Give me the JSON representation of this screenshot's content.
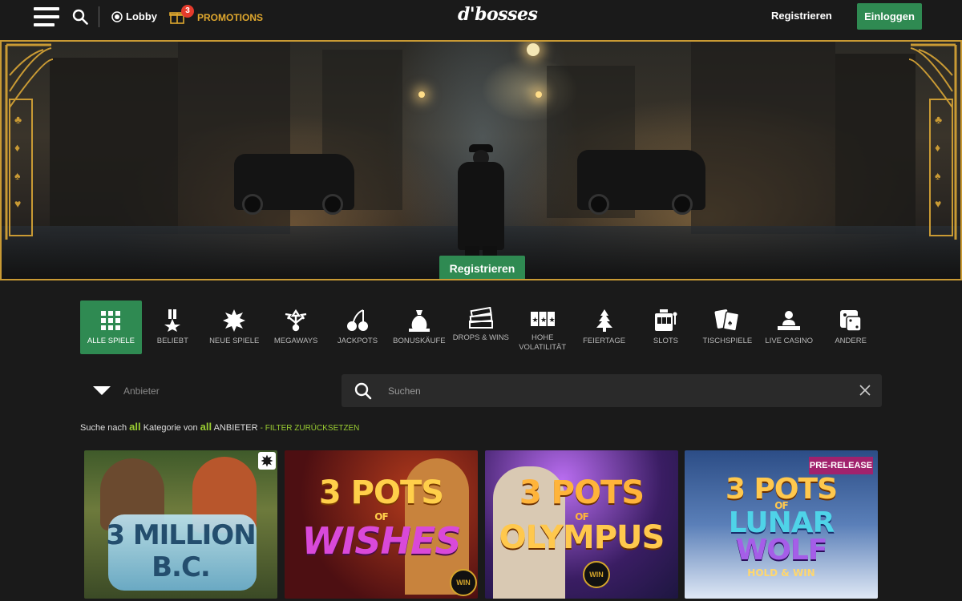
{
  "header": {
    "lobby_label": "Lobby",
    "promo_count": "3",
    "promo_label": "PROMOTIONS",
    "logo_text": "d'bosses",
    "register_label": "Registrieren",
    "login_label": "Einloggen"
  },
  "banner": {
    "cta_label": "Registrieren"
  },
  "categories": [
    {
      "label": "ALLE SPIELE",
      "icon": "grid-icon",
      "active": true
    },
    {
      "label": "BELIEBT",
      "icon": "medal-icon"
    },
    {
      "label": "NEUE SPIELE",
      "icon": "burst-icon"
    },
    {
      "label": "MEGAWAYS",
      "icon": "arrows-icon"
    },
    {
      "label": "JACKPOTS",
      "icon": "cherries-icon"
    },
    {
      "label": "BONUSKÄUFE",
      "icon": "money-bag-icon"
    },
    {
      "label": "DROPS & WINS",
      "icon": "stack-icon"
    },
    {
      "label": "HOHE VOLATILITÄT",
      "icon": "stars-icon"
    },
    {
      "label": "FEIERTAGE",
      "icon": "tree-icon"
    },
    {
      "label": "SLOTS",
      "icon": "slot-machine-icon"
    },
    {
      "label": "TISCHSPIELE",
      "icon": "cards-icon"
    },
    {
      "label": "LIVE CASINO",
      "icon": "dealer-icon"
    },
    {
      "label": "ANDERE",
      "icon": "dice-icon"
    }
  ],
  "filter": {
    "provider_placeholder": "Anbieter",
    "search_placeholder": "Suchen"
  },
  "summary": {
    "prefix": "Suche nach",
    "category_value": "all",
    "middle": "Kategorie von",
    "provider_value": "all",
    "suffix": "ANBIETER",
    "reset_label": "- FILTER ZURÜCKSETZEN"
  },
  "games": [
    {
      "line1": "3 MILLION",
      "line2": "B.C."
    },
    {
      "line1": "3 POTS",
      "line2": "OF",
      "line3": "WISHES"
    },
    {
      "line1": "3 POTS",
      "line2": "OF",
      "line3": "OLYMPUS"
    },
    {
      "badge": "PRE-RELEASE",
      "line1": "3 POTS",
      "line2": "OF",
      "line3": "LUNAR",
      "line4": "WOLF",
      "line5": "HOLD & WIN"
    }
  ],
  "colors": {
    "accent_green": "#2f8a52",
    "gold": "#c99a34",
    "promo": "#e0a82e",
    "highlight": "#9acd32"
  }
}
